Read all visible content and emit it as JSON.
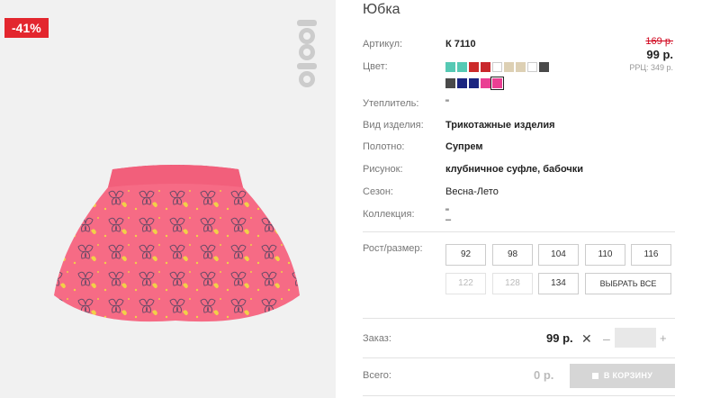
{
  "product": {
    "discount_badge": "-41%",
    "title": "Юбка",
    "brand_logo_text": "crockid"
  },
  "details": {
    "article_label": "Артикул:",
    "article_value": "К 7110",
    "color_label": "Цвет:",
    "insulation_label": "Утеплитель:",
    "insulation_value": "\"",
    "type_label": "Вид изделия:",
    "type_value": "Трикотажные изделия",
    "fabric_label": "Полотно:",
    "fabric_value": "Супрем",
    "pattern_label": "Рисунок:",
    "pattern_value": "клубничное суфле, бабочки",
    "season_label": "Сезон:",
    "season_value": "Весна-Лето",
    "collection_label": "Коллекция:",
    "collection_value_1": "\"",
    "collection_value_2": "–",
    "size_label": "Рост/размер:"
  },
  "price": {
    "old": "169 р.",
    "current": "99 р.",
    "rrp": "РРЦ: 349 р."
  },
  "colors": [
    "#56c9b4",
    "#56c9b4",
    "#cc2b2b",
    "#c9282d",
    "#ffffff",
    "#ddd0b4",
    "#ddd0b4",
    "#ffffff",
    "#4a4a4a",
    "#4a4a4a",
    "#1b2580",
    "#1b2580",
    "#ea3f93",
    "#ea3f93"
  ],
  "selected_color_index": 13,
  "sizes": {
    "row1": [
      "92",
      "98",
      "104",
      "110",
      "116"
    ],
    "row2": [
      "122",
      "128",
      "134"
    ],
    "select_all": "ВЫБРАТЬ ВСЕ"
  },
  "order": {
    "label": "Заказ:",
    "price": "99 р.",
    "times": "✕",
    "minus": "–",
    "plus": "+",
    "quantity": ""
  },
  "total": {
    "label": "Всего:",
    "value": "0 р.",
    "cart_button": "В КОРЗИНУ"
  }
}
